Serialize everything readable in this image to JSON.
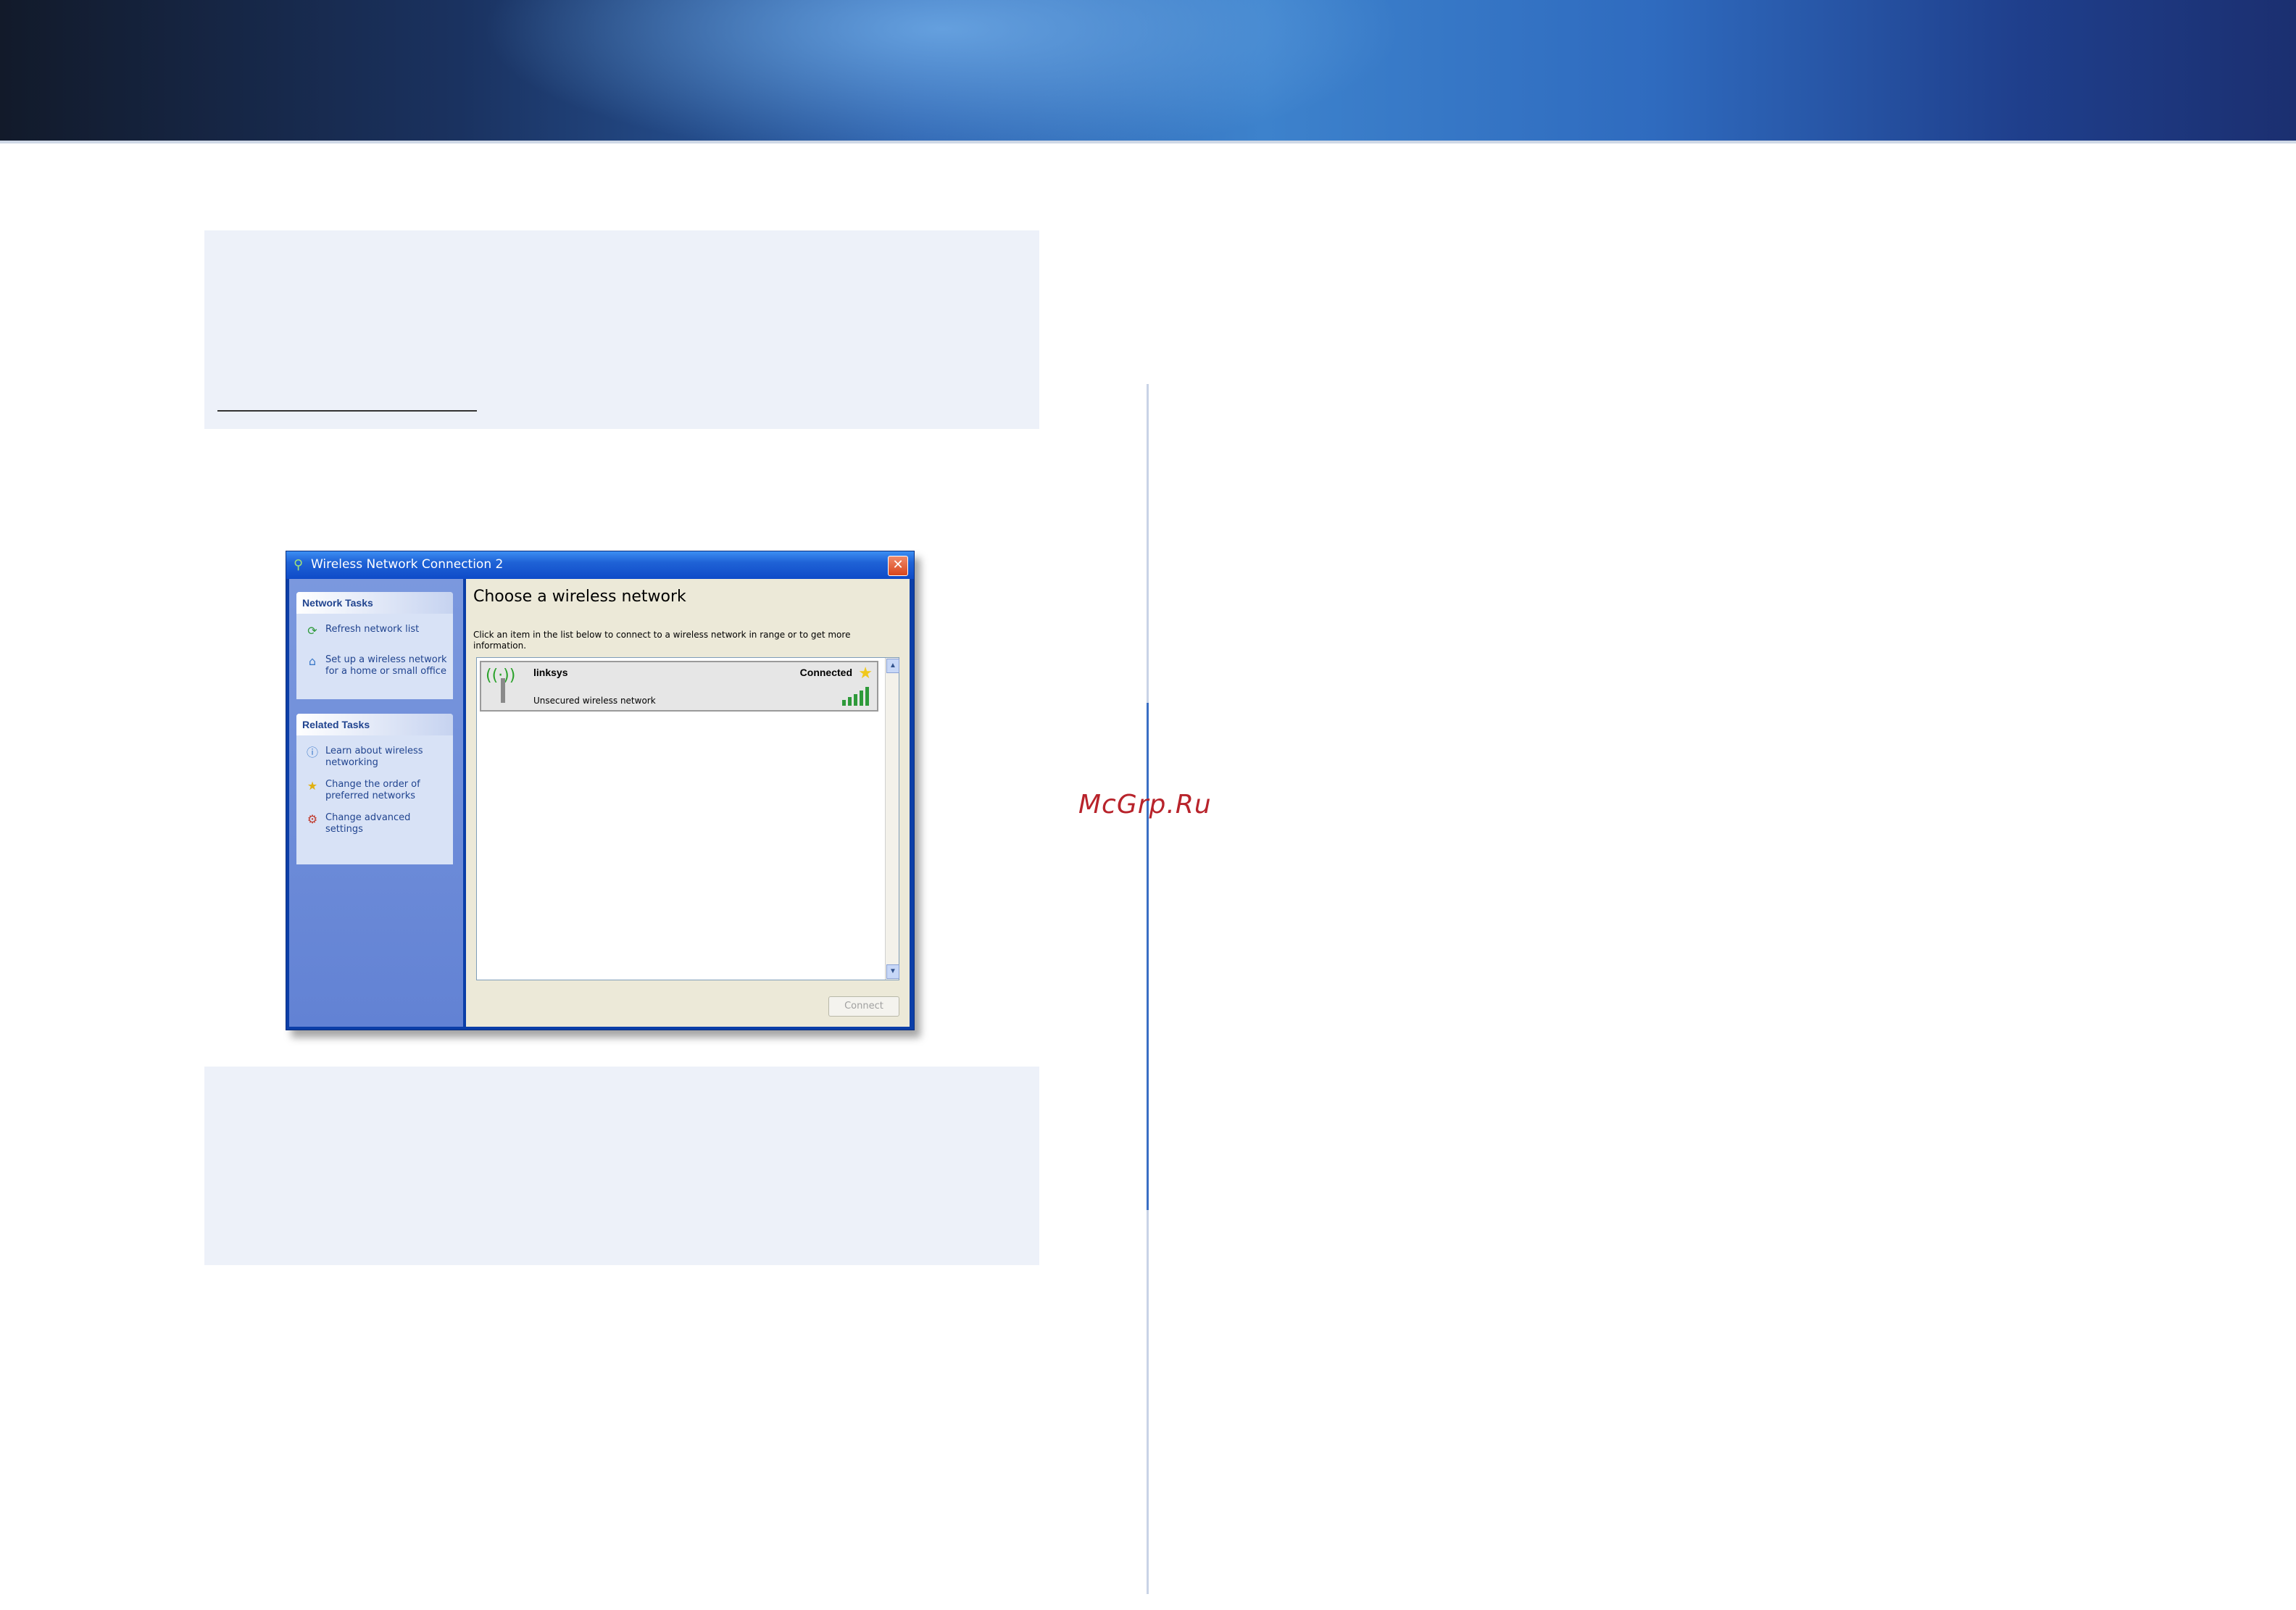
{
  "watermark": "McGrp.Ru",
  "dialog": {
    "title": "Wireless Network Connection 2",
    "close_glyph": "✕",
    "sidebar": {
      "network_tasks": {
        "header": "Network Tasks",
        "items": [
          {
            "line1": "Refresh network list",
            "line2": "",
            "icon": "refresh-icon"
          },
          {
            "line1": "Set up a wireless network",
            "line2": "for a home or small office",
            "icon": "setup-network-icon"
          }
        ]
      },
      "related_tasks": {
        "header": "Related Tasks",
        "items": [
          {
            "line1": "Learn about wireless",
            "line2": "networking",
            "icon": "info-icon"
          },
          {
            "line1": "Change the order of",
            "line2": "preferred networks",
            "icon": "star-icon"
          },
          {
            "line1": "Change advanced",
            "line2": "settings",
            "icon": "settings-icon"
          }
        ]
      }
    },
    "main": {
      "heading": "Choose a wireless network",
      "instructions": "Click an item in the list below to connect to a wireless network in range or to get more information.",
      "networks": [
        {
          "name": "linksys",
          "status": "Connected",
          "security": "Unsecured wireless network",
          "signal_bars": 5
        }
      ],
      "connect_label": "Connect"
    }
  },
  "colors": {
    "accent_blue": "#3a6fc4",
    "note_background": "#edf1f9",
    "watermark": "#b8232b"
  }
}
